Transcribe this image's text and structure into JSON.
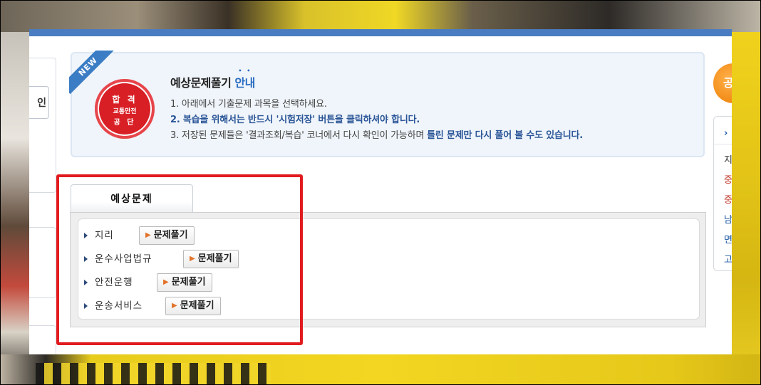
{
  "left_panel": {
    "tab_label": "인"
  },
  "guide": {
    "badge": "NEW",
    "seal": {
      "line1": "합 격",
      "line2": "교통안전",
      "line3": "공 단"
    },
    "title_main": "예상문제풀기 ",
    "title_accent": "안내",
    "line1": "1. 아래에서 기출문제 과목을 선택하세요.",
    "line2": "2. 복습을 위해서는 반드시 '시험저장' 버튼을 클릭하셔야 합니다.",
    "line3_pre": "3. 저장된 문제들은 '결과조회/복습' 코너에서 다시 확인이 가능하며 ",
    "line3_hl": "틀린 문제만 다시 풀어 볼 수도 있습니다."
  },
  "tabs": {
    "active": "예상문제"
  },
  "subjects": [
    {
      "name": "지리",
      "button": "문제풀기"
    },
    {
      "name": "운수사업법규",
      "button": "문제풀기"
    },
    {
      "name": "안전운행",
      "button": "문제풀기"
    },
    {
      "name": "운송서비스",
      "button": "문제풀기"
    }
  ],
  "right_panel": {
    "circle_text": "공",
    "head": "›",
    "items": [
      "지",
      "중",
      "중",
      "남",
      "면",
      "고"
    ]
  },
  "colors": {
    "window_top_bar": "#4a7cc1",
    "highlight_outline": "#e11b1f",
    "accent_blue": "#2a5597",
    "seal_red": "#d91f26"
  }
}
